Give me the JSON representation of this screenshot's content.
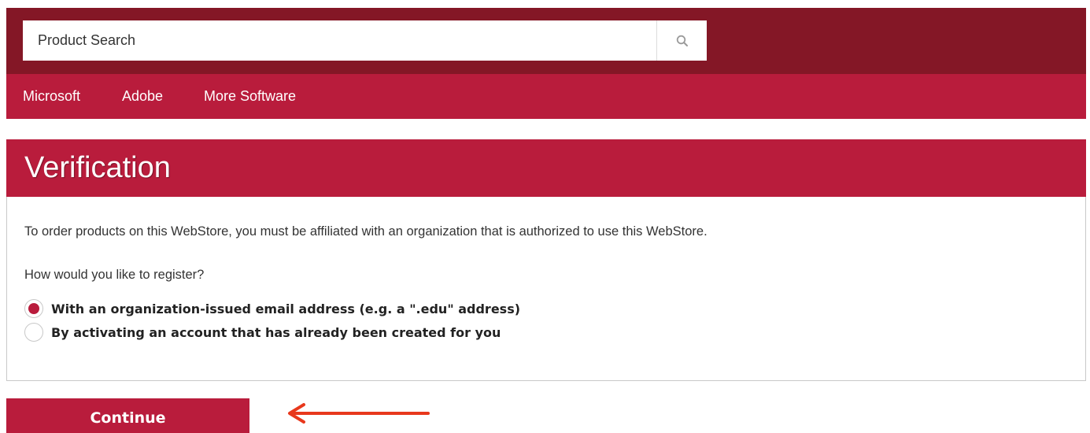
{
  "search": {
    "placeholder": "Product Search",
    "icon": "search-icon"
  },
  "nav": {
    "items": [
      {
        "label": "Microsoft"
      },
      {
        "label": "Adobe"
      },
      {
        "label": "More Software"
      }
    ]
  },
  "panel": {
    "title": "Verification",
    "intro": "To order products on this WebStore, you must be affiliated with an organization that is authorized to use this WebStore.",
    "question": "How would you like to register?",
    "options": [
      {
        "label": "With an organization-issued email address (e.g. a \".edu\" address)",
        "selected": true
      },
      {
        "label": "By activating an account that has already been created for you",
        "selected": false
      }
    ]
  },
  "actions": {
    "continue_label": "Continue"
  },
  "colors": {
    "header_dark": "#841726",
    "brand_red": "#b91c3c",
    "annotation_arrow": "#e8381c"
  }
}
